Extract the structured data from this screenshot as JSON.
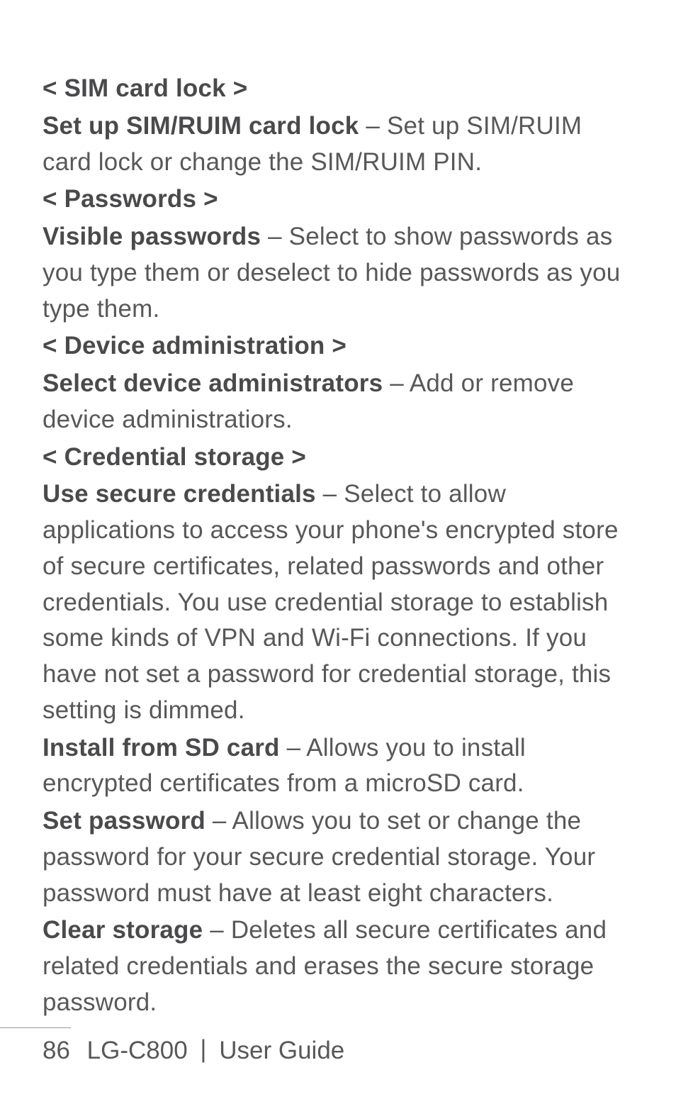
{
  "sections": {
    "sim_lock": {
      "heading": "< SIM card lock >",
      "item_label": "Set up SIM/RUIM card lock",
      "item_desc": " – Set up SIM/RUIM card lock or change the SIM/RUIM PIN."
    },
    "passwords": {
      "heading": "< Passwords >",
      "item_label": "Visible passwords",
      "item_desc": " – Select to show passwords as you type them or deselect to hide passwords as you type them."
    },
    "device_admin": {
      "heading": "< Device administration >",
      "item_label": "Select device administrators",
      "item_desc": " – Add or remove device administratiors."
    },
    "credential": {
      "heading": "< Credential storage >",
      "use_secure_label": "Use secure credentials",
      "use_secure_desc": " – Select to allow applications to access your phone's encrypted store of secure certificates, related passwords and other credentials. You use credential storage to establish some kinds of VPN and Wi-Fi connections. If you have not set a password for credential storage, this setting is dimmed.",
      "install_label": "Install from SD card",
      "install_desc": " – Allows you to install encrypted certificates from a microSD card.",
      "set_pw_label": "Set password",
      "set_pw_desc": " – Allows you to set or change the password for your secure credential storage. Your password must have at least eight characters.",
      "clear_label": "Clear storage",
      "clear_desc": " – Deletes all secure certificates and related credentials and erases the secure storage password."
    }
  },
  "footer": {
    "page_number": "86",
    "model": "LG-C800 ",
    "separator": "|",
    "guide": " User Guide"
  }
}
